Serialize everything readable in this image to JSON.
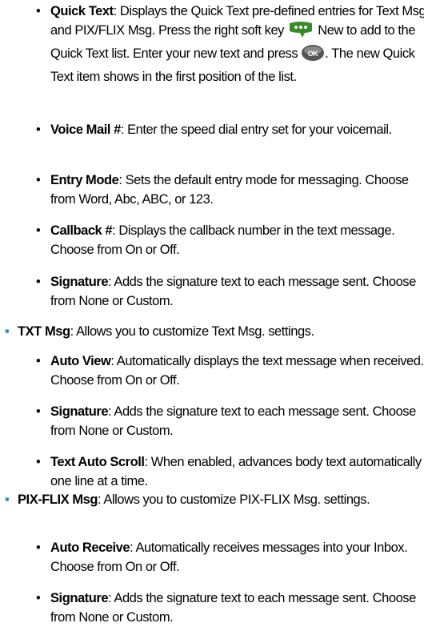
{
  "items": {
    "quick_text": {
      "term": "Quick Text",
      "text_a": ": Displays the Quick Text pre-defined entries for Text Msg and PIX/FLIX Msg. Press the right soft key ",
      "text_b": " New to add to the Quick Text list. Enter your new text and press ",
      "text_c": ". The new Quick Text item shows in the first position of the list."
    },
    "voice_mail": {
      "term": "Voice Mail #",
      "text": ": Enter the speed dial entry set for your voicemail."
    },
    "entry_mode": {
      "term": "Entry Mode",
      "text": ": Sets the default entry mode for messaging. Choose from Word, Abc, ABC, or 123."
    },
    "callback": {
      "term": "Callback #",
      "text": ": Displays the callback number in the text message. Choose from On or Off."
    },
    "signature_1": {
      "term": "Signature",
      "text": ": Adds the signature text to each message sent. Choose from None or Custom."
    },
    "txt_msg": {
      "term": "TXT Msg",
      "text": ":  Allows you to customize Text Msg. settings."
    },
    "auto_view": {
      "term": "Auto View",
      "text": ": Automatically displays the text message when received. Choose from On or Off."
    },
    "signature_2": {
      "term": "Signature",
      "text": ": Adds the signature text to each message sent. Choose from None or Custom."
    },
    "text_auto_scroll": {
      "term": "Text Auto Scroll",
      "text": ": When enabled, advances body text automatically one line at a time."
    },
    "pix_flix_msg": {
      "term": "PIX-FLIX Msg",
      "text": ": Allows you to customize PIX-FLIX Msg. settings."
    },
    "auto_receive": {
      "term": "Auto Receive",
      "text": ": Automatically receives messages into your Inbox. Choose from On or Off."
    },
    "signature_3": {
      "term": "Signature",
      "text": ": Adds the signature text to each message sent. Choose from None or Custom."
    }
  },
  "icons": {
    "soft_key": "right-soft-key-icon",
    "ok": "ok-key-icon"
  },
  "ok_label": "OK",
  "colors": {
    "top_bullet": "#1d8fd3",
    "ok_key": "#555555",
    "soft_key": "#3a8a2a"
  }
}
